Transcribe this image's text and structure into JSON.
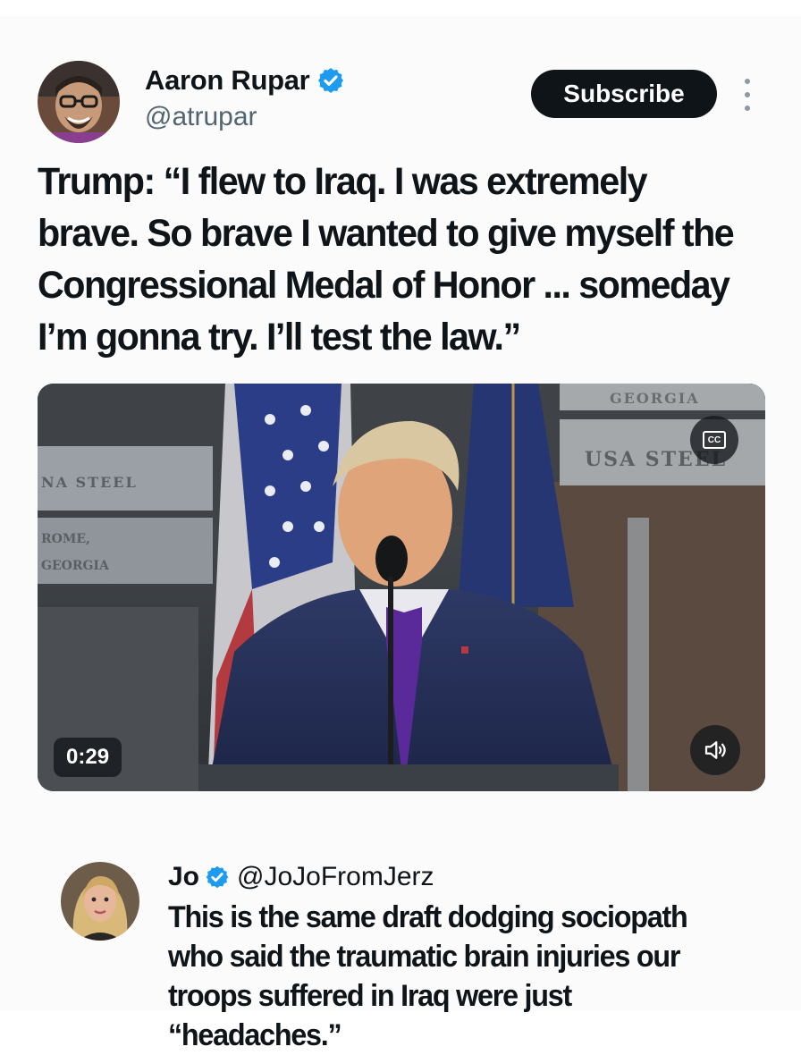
{
  "tweet": {
    "author_name": "Aaron Rupar",
    "author_handle": "@atrupar",
    "subscribe_label": "Subscribe",
    "text": "Trump: “I flew to Iraq. I was extremely brave. So brave I wanted to give myself the Congressional Medal of Honor ... someday I’m gonna try. I’ll test the law.”",
    "video": {
      "duration": "0:29",
      "cc_label": "CC",
      "sign_left_top": "NA STEEL",
      "sign_left_bottom_1": "ROME,",
      "sign_left_bottom_2": "GEORGIA",
      "sign_right_top": "GEORGIA",
      "sign_right_middle": "USA STEEL"
    }
  },
  "reply": {
    "name": "Jo",
    "handle": "@JoJoFromJerz",
    "text": "This is the same draft dodging sociopath who said the traumatic brain injuries our troops suffered in Iraq were just “headaches.”"
  },
  "colors": {
    "verified": "#1d9bf0",
    "subscribe_bg": "#0f1419",
    "handle_gray": "#536471"
  },
  "icons": [
    "verified-badge-icon",
    "more-options-icon",
    "closed-captions-icon",
    "volume-icon"
  ]
}
